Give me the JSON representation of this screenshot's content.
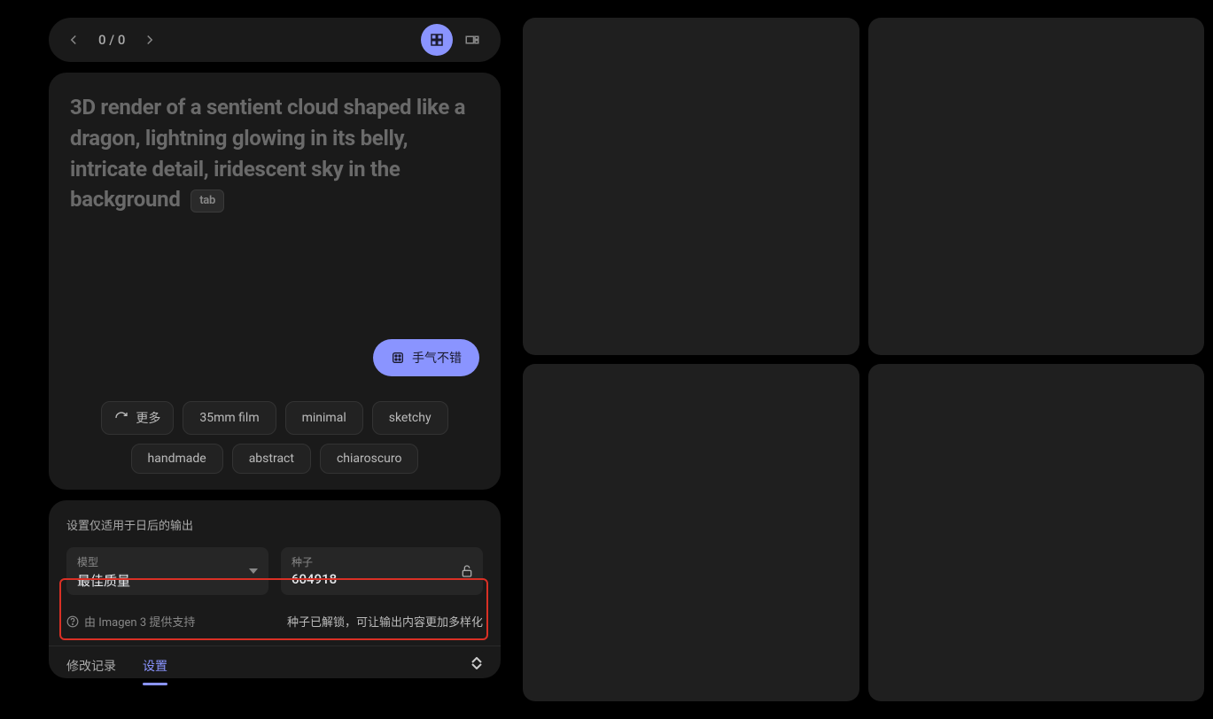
{
  "topbar": {
    "page_counter": "0 / 0"
  },
  "prompt": {
    "placeholder": "3D render of a sentient cloud shaped like a dragon, lightning glowing in its belly, intricate detail, iridescent sky in the background",
    "tab_hint": "tab"
  },
  "lucky": {
    "label": "手气不错"
  },
  "chips": {
    "more_label": "更多",
    "items": [
      "35mm film",
      "minimal",
      "sketchy",
      "handmade",
      "abstract",
      "chiaroscuro"
    ]
  },
  "settings": {
    "note": "设置仅适用于日后的输出",
    "model": {
      "label": "模型",
      "value": "最佳质量"
    },
    "seed": {
      "label": "种子",
      "value": "604918"
    },
    "support": {
      "left": "由 Imagen 3 提供支持",
      "right": "种子已解锁，可让输出内容更加多样化"
    },
    "tabs": {
      "history": "修改记录",
      "settings": "设置"
    }
  }
}
